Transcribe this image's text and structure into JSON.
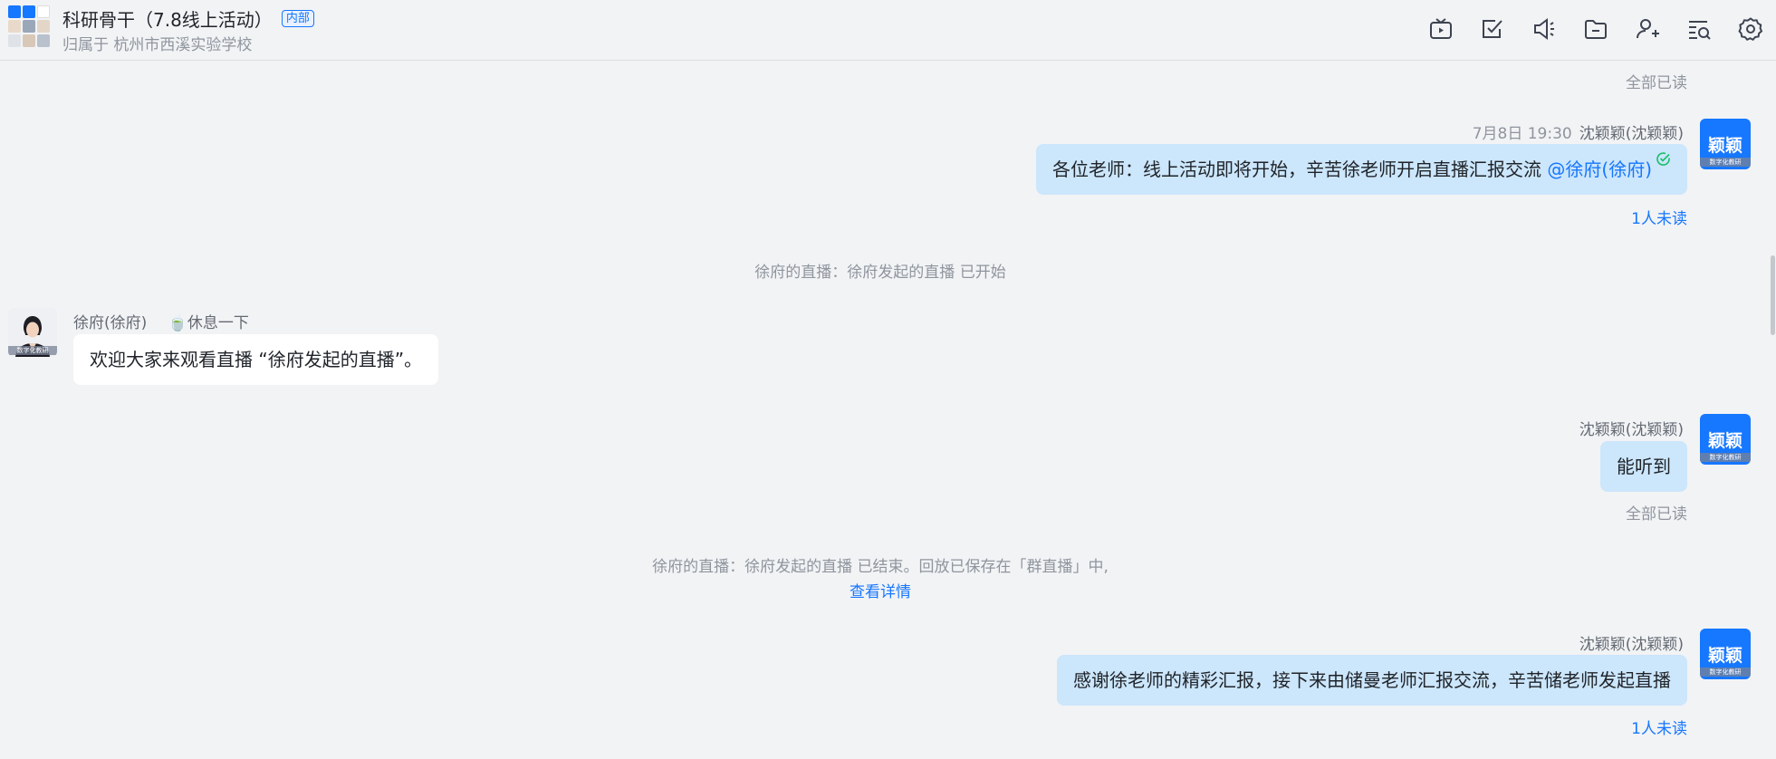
{
  "header": {
    "title": "科研骨干（7.8线上活动）",
    "tag": "内部",
    "subtitle": "归属于 杭州市西溪实验学校",
    "avatar_colors": [
      "#1677ff",
      "#1677ff",
      "#ffffff",
      "#f0e6dc",
      "#d9e3ef",
      "#f3ece4",
      "#e6e9ee",
      "#efe6dd",
      "#e0e4ea"
    ],
    "toolbar_icons": [
      "live-tv-icon",
      "task-check-icon",
      "announcement-icon",
      "folder-icon",
      "add-member-icon",
      "search-history-icon",
      "settings-icon"
    ]
  },
  "messages": {
    "read_all_top": "全部已读",
    "msg1": {
      "time": "7月8日 19:30",
      "sender": "沈颖颖(沈颖颖)",
      "text": "各位老师：线上活动即将开始，辛苦徐老师开启直播汇报交流 ",
      "mention": "@徐府(徐府)",
      "status": "1人未读",
      "avatar_text": "颖颖",
      "avatar_ribbon": "数字化教研"
    },
    "system1": "徐府的直播：徐府发起的直播 已开始",
    "msg2": {
      "sender": "徐府(徐府)",
      "user_status": "🍵休息一下",
      "text": "欢迎大家来观看直播 “徐府发起的直播”。",
      "avatar_ribbon": "数字化教研"
    },
    "msg3": {
      "sender": "沈颖颖(沈颖颖)",
      "text": "能听到",
      "status": "全部已读",
      "avatar_text": "颖颖",
      "avatar_ribbon": "数字化教研"
    },
    "system2": "徐府的直播：徐府发起的直播 已结束。回放已保存在「群直播」中,",
    "system2_link": "查看详情",
    "msg4": {
      "sender": "沈颖颖(沈颖颖)",
      "text": "感谢徐老师的精彩汇报，接下来由储曼老师汇报交流，辛苦储老师发起直播",
      "status": "1人未读",
      "avatar_text": "颖颖",
      "avatar_ribbon": "数字化教研"
    }
  },
  "colors": {
    "accent": "#1677ff",
    "my_bubble": "#cce6fb",
    "other_bubble": "#ffffff",
    "background": "#f2f3f5",
    "read_check": "#19be6b"
  }
}
